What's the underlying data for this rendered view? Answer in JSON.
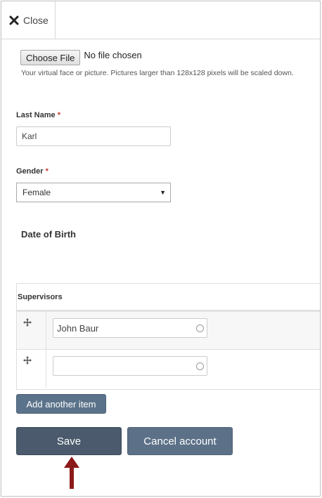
{
  "header": {
    "close_label": "Close",
    "close_icon": "close-x-icon"
  },
  "picture": {
    "choose_file_label": "Choose File",
    "no_file_text": "No file chosen",
    "help_text": "Your virtual face or picture. Pictures larger than 128x128 pixels will be scaled down."
  },
  "last_name": {
    "label": "Last Name",
    "required_mark": "*",
    "value": "Karl"
  },
  "gender": {
    "label": "Gender",
    "required_mark": "*",
    "selected": "Female",
    "arrow": "▼"
  },
  "date_of_birth": {
    "heading": "Date of Birth"
  },
  "supervisors": {
    "heading": "Supervisors",
    "rows": [
      {
        "value": "John Baur"
      },
      {
        "value": ""
      }
    ],
    "add_item_label": "Add another item"
  },
  "actions": {
    "save_label": "Save",
    "cancel_label": "Cancel account"
  },
  "colors": {
    "required": "#c0392b",
    "arrow": "#8b1a1a",
    "save_bg": "#4b5b6d",
    "cancel_bg": "#5c7188",
    "add_bg": "#5b738a"
  }
}
